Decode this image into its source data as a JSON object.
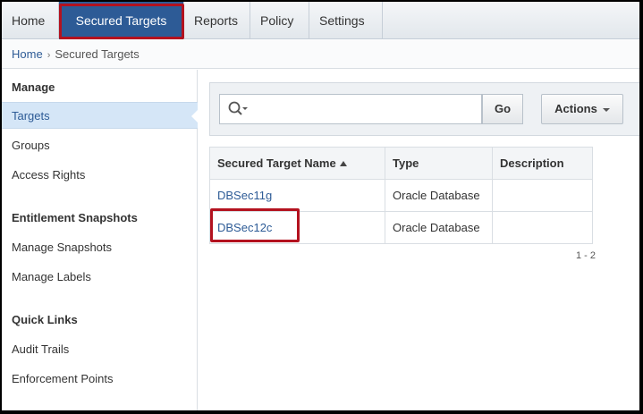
{
  "topnav": {
    "tabs": [
      {
        "label": "Home"
      },
      {
        "label": "Secured Targets"
      },
      {
        "label": "Reports"
      },
      {
        "label": "Policy"
      },
      {
        "label": "Settings"
      }
    ]
  },
  "breadcrumb": {
    "home": "Home",
    "separator": "›",
    "current": "Secured Targets"
  },
  "sidebar": {
    "manage_heading": "Manage",
    "manage_items": [
      {
        "label": "Targets"
      },
      {
        "label": "Groups"
      },
      {
        "label": "Access Rights"
      }
    ],
    "snapshots_heading": "Entitlement Snapshots",
    "snapshot_items": [
      {
        "label": "Manage Snapshots"
      },
      {
        "label": "Manage Labels"
      }
    ],
    "quicklinks_heading": "Quick Links",
    "quicklink_items": [
      {
        "label": "Audit Trails"
      },
      {
        "label": "Enforcement Points"
      }
    ]
  },
  "toolbar": {
    "search_value": "",
    "go_label": "Go",
    "actions_label": "Actions"
  },
  "table": {
    "headers": [
      "Secured Target Name",
      "Type",
      "Description"
    ],
    "rows": [
      {
        "name": "DBSec11g",
        "type": "Oracle Database",
        "description": ""
      },
      {
        "name": "DBSec12c",
        "type": "Oracle Database",
        "description": ""
      }
    ],
    "pager": "1 - 2"
  },
  "colors": {
    "accent": "#2d5b96",
    "highlight": "#b3121f",
    "selected_bg": "#d5e6f7"
  }
}
